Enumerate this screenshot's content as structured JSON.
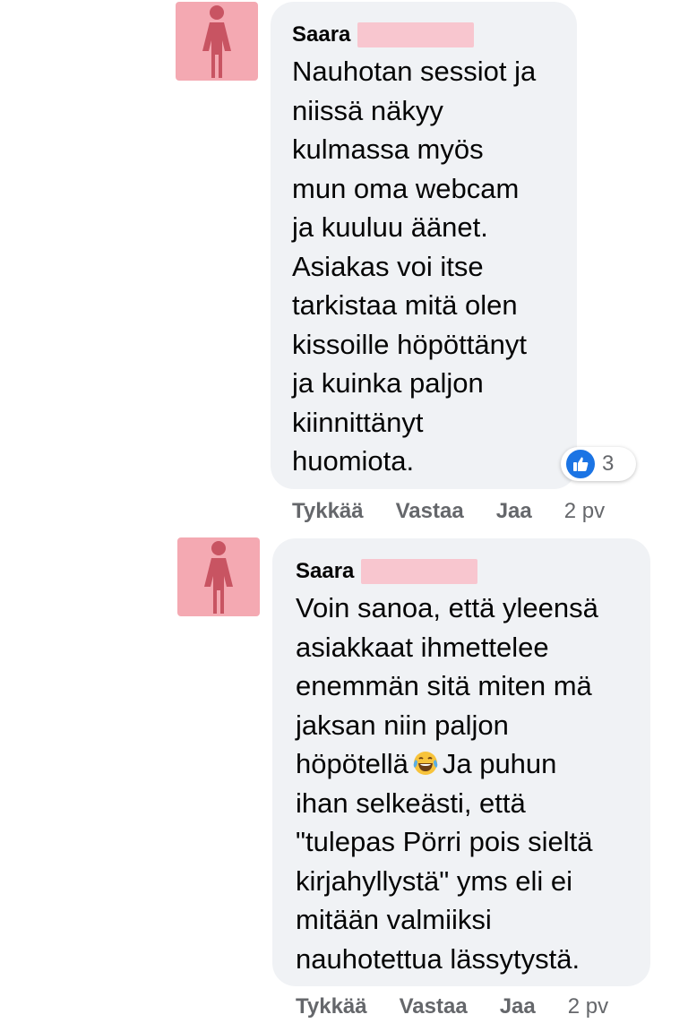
{
  "colors": {
    "avatar_bg": "#f4a9b2",
    "avatar_figure": "#c85462",
    "redaction": "#f8c6cf",
    "bubble_bg": "#f0f2f5",
    "action_text": "#65676b",
    "like_blue": "#1b74e4"
  },
  "comments": [
    {
      "author": "Saara",
      "avatar_icon": "female-person-icon",
      "text": "Nauhotan sessiot ja\nniissä näkyy\nkulmassa myös\nmun oma webcam\nja kuuluu äänet.\nAsiakas voi itse\ntarkistaa mitä olen\nkissoille höpöttänyt\nja kuinka paljon\nkiinnittänyt\nhuomiota.",
      "reaction_icon": "thumbs-up-icon",
      "reaction_count": "3",
      "actions": {
        "like": "Tykkää",
        "reply": "Vastaa",
        "share": "Jaa",
        "time": "2 pv"
      }
    },
    {
      "author": "Saara",
      "avatar_icon": "female-person-icon",
      "text_before_emoji": "Voin sanoa, että yleensä\nasiakkaat ihmettelee\nenemmän sitä miten mä\njaksan niin paljon\nhöpötellä",
      "emoji": "tears-of-joy-emoji",
      "text_after_emoji": "Ja puhun\nihan selkeästi, että\n\"tulepas Pörri pois sieltä\nkirjahyllystä\" yms eli ei\nmitään valmiiksi\nnauhotettua lässytystä.",
      "actions": {
        "like": "Tykkää",
        "reply": "Vastaa",
        "share": "Jaa",
        "time": "2 pv"
      }
    }
  ]
}
